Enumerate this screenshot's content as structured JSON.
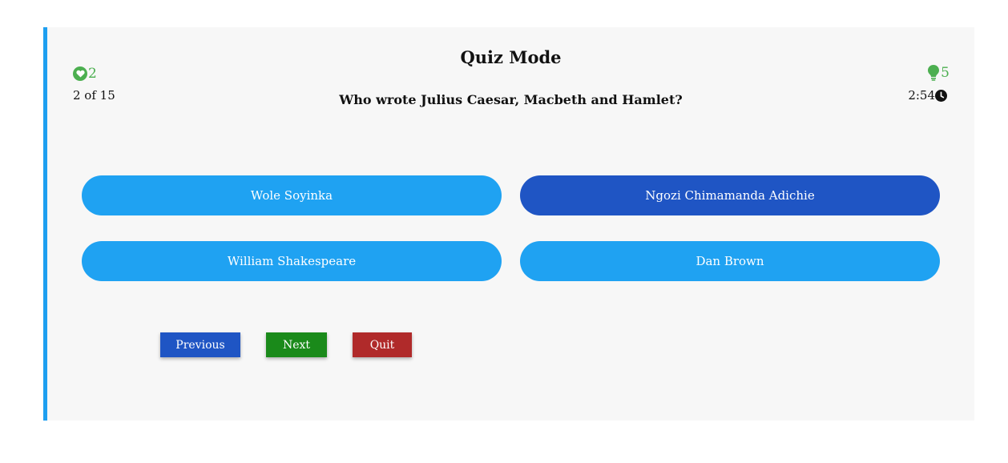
{
  "quiz": {
    "title": "Quiz Mode",
    "question": "Who wrote Julius Caesar, Macbeth and Hamlet?",
    "progress": "2 of 15",
    "lives": "2",
    "hints": "5",
    "timer": "2:54"
  },
  "options": [
    {
      "label": "Wole Soyinka",
      "selected": false
    },
    {
      "label": "Ngozi Chimamanda Adichie",
      "selected": true
    },
    {
      "label": "William Shakespeare",
      "selected": false
    },
    {
      "label": "Dan Brown",
      "selected": false
    }
  ],
  "buttons": {
    "previous": "Previous",
    "next": "Next",
    "quit": "Quit"
  },
  "icons": {
    "lives": "heart-icon",
    "hints": "lightbulb-icon",
    "timer": "clock-icon"
  },
  "colors": {
    "accent": "#1e9ff0",
    "option": "#1fa2f2",
    "selected_option": "#1f55c4",
    "previous": "#1f55c4",
    "next": "#1a8a1a",
    "quit": "#b02a2a",
    "status_green": "#4caf50"
  }
}
